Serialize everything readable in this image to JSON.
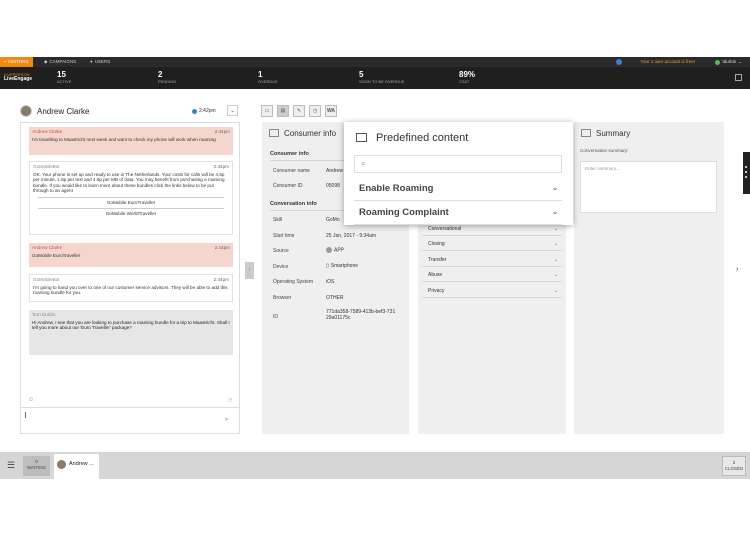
{
  "topbar": {
    "tabs": [
      {
        "label": "VISITORS",
        "active": true
      },
      {
        "label": "CAMPAIGNS",
        "active": false
      },
      {
        "label": "USERS",
        "active": false
      }
    ],
    "notice": "Your 1 user account is free!",
    "user": "tdurbin"
  },
  "brand": {
    "line1": "LIVEPERSON",
    "line2": "LiveEngage"
  },
  "stats": [
    {
      "value": "15",
      "label": "ACTIVE"
    },
    {
      "value": "2",
      "label": "PENDING"
    },
    {
      "value": "1",
      "label": "OVERDUE"
    },
    {
      "value": "5",
      "label": "SOON TO BE OVERDUE"
    },
    {
      "value": "89%",
      "label": "CSAT"
    }
  ],
  "conversation": {
    "name": "Andrew Clarke",
    "time": "2:42pm"
  },
  "toolbar": {
    "wa_label": "WA"
  },
  "messages": [
    {
      "name": "Andrew Clarke",
      "time": "2:44pm",
      "text": "I'm travelling to Maastricht next week and want to check my phone will work when roaming"
    },
    {
      "name": "GoMobileBot",
      "time": "2:44pm",
      "text": "OK. Your phone is set up and ready to use in The Netherlands. Your costs for calls will be 4.6p per minute, 1.8p per text and 4.6p per MB of data. You may benefit from purchasing a roaming bundle. If you would like to learn more about these bundles click the links below to be put through to an agent",
      "options": [
        "GoMobile EuroTraveller",
        "GoMobile WorldTraveller"
      ]
    },
    {
      "name": "Andrew Clarke",
      "time": "2:44pm",
      "text": "GoMobile EuroTraveller"
    },
    {
      "name": "GoMobileBot",
      "time": "2:44pm",
      "text": "I'm going to hand you over to one of our customer service advisors. They will be able to add this roaming bundle for you."
    },
    {
      "name": "Tom Durbin",
      "time": "",
      "text": "Hi Andrew, I see that you are looking to purchase a roaming bundle for a trip to Maastricht. Shall I tell you more about our 'Euro Traveller' package?"
    }
  ],
  "consumer_info": {
    "title": "Consumer info",
    "section1": "Consumer info",
    "consumer_name_label": "Consumer name",
    "consumer_name_value": "Andrew",
    "consumer_id_label": "Consumer ID",
    "consumer_id_value": "05098",
    "section2": "Conversation info",
    "skill_label": "Skill",
    "skill_value": "GoMo",
    "start_label": "Start time",
    "start_value": "25 Jan, 2017 - 9:34am",
    "source_label": "Source",
    "source_value": "APP",
    "device_label": "Device",
    "device_value": "Smartphone",
    "os_label": "Operating System",
    "os_value": "iOS",
    "browser_label": "Browser",
    "browser_value": "OTHER",
    "id_label": "ID",
    "id_value": "771da358-7589-413b-bef3-73129a01175c"
  },
  "categories": [
    "Conversational",
    "Closing",
    "Transfer",
    "Abuse",
    "Privacy"
  ],
  "summary": {
    "title": "Summary",
    "label": "Conversation summary:",
    "placeholder": "Enter summary..."
  },
  "predefined": {
    "title": "Predefined content",
    "items": [
      "Enable Roaming",
      "Roaming Complaint"
    ]
  },
  "bottom": {
    "waiting_count": "0",
    "waiting_label": "WAITING",
    "tab_name": "Andrew ...",
    "closed_count": "2",
    "closed_label": "CLOSED"
  },
  "colors": {
    "accent": "#f08a12",
    "consumer_bubble": "#f4d6cc",
    "dark": "#1f1f1f"
  }
}
